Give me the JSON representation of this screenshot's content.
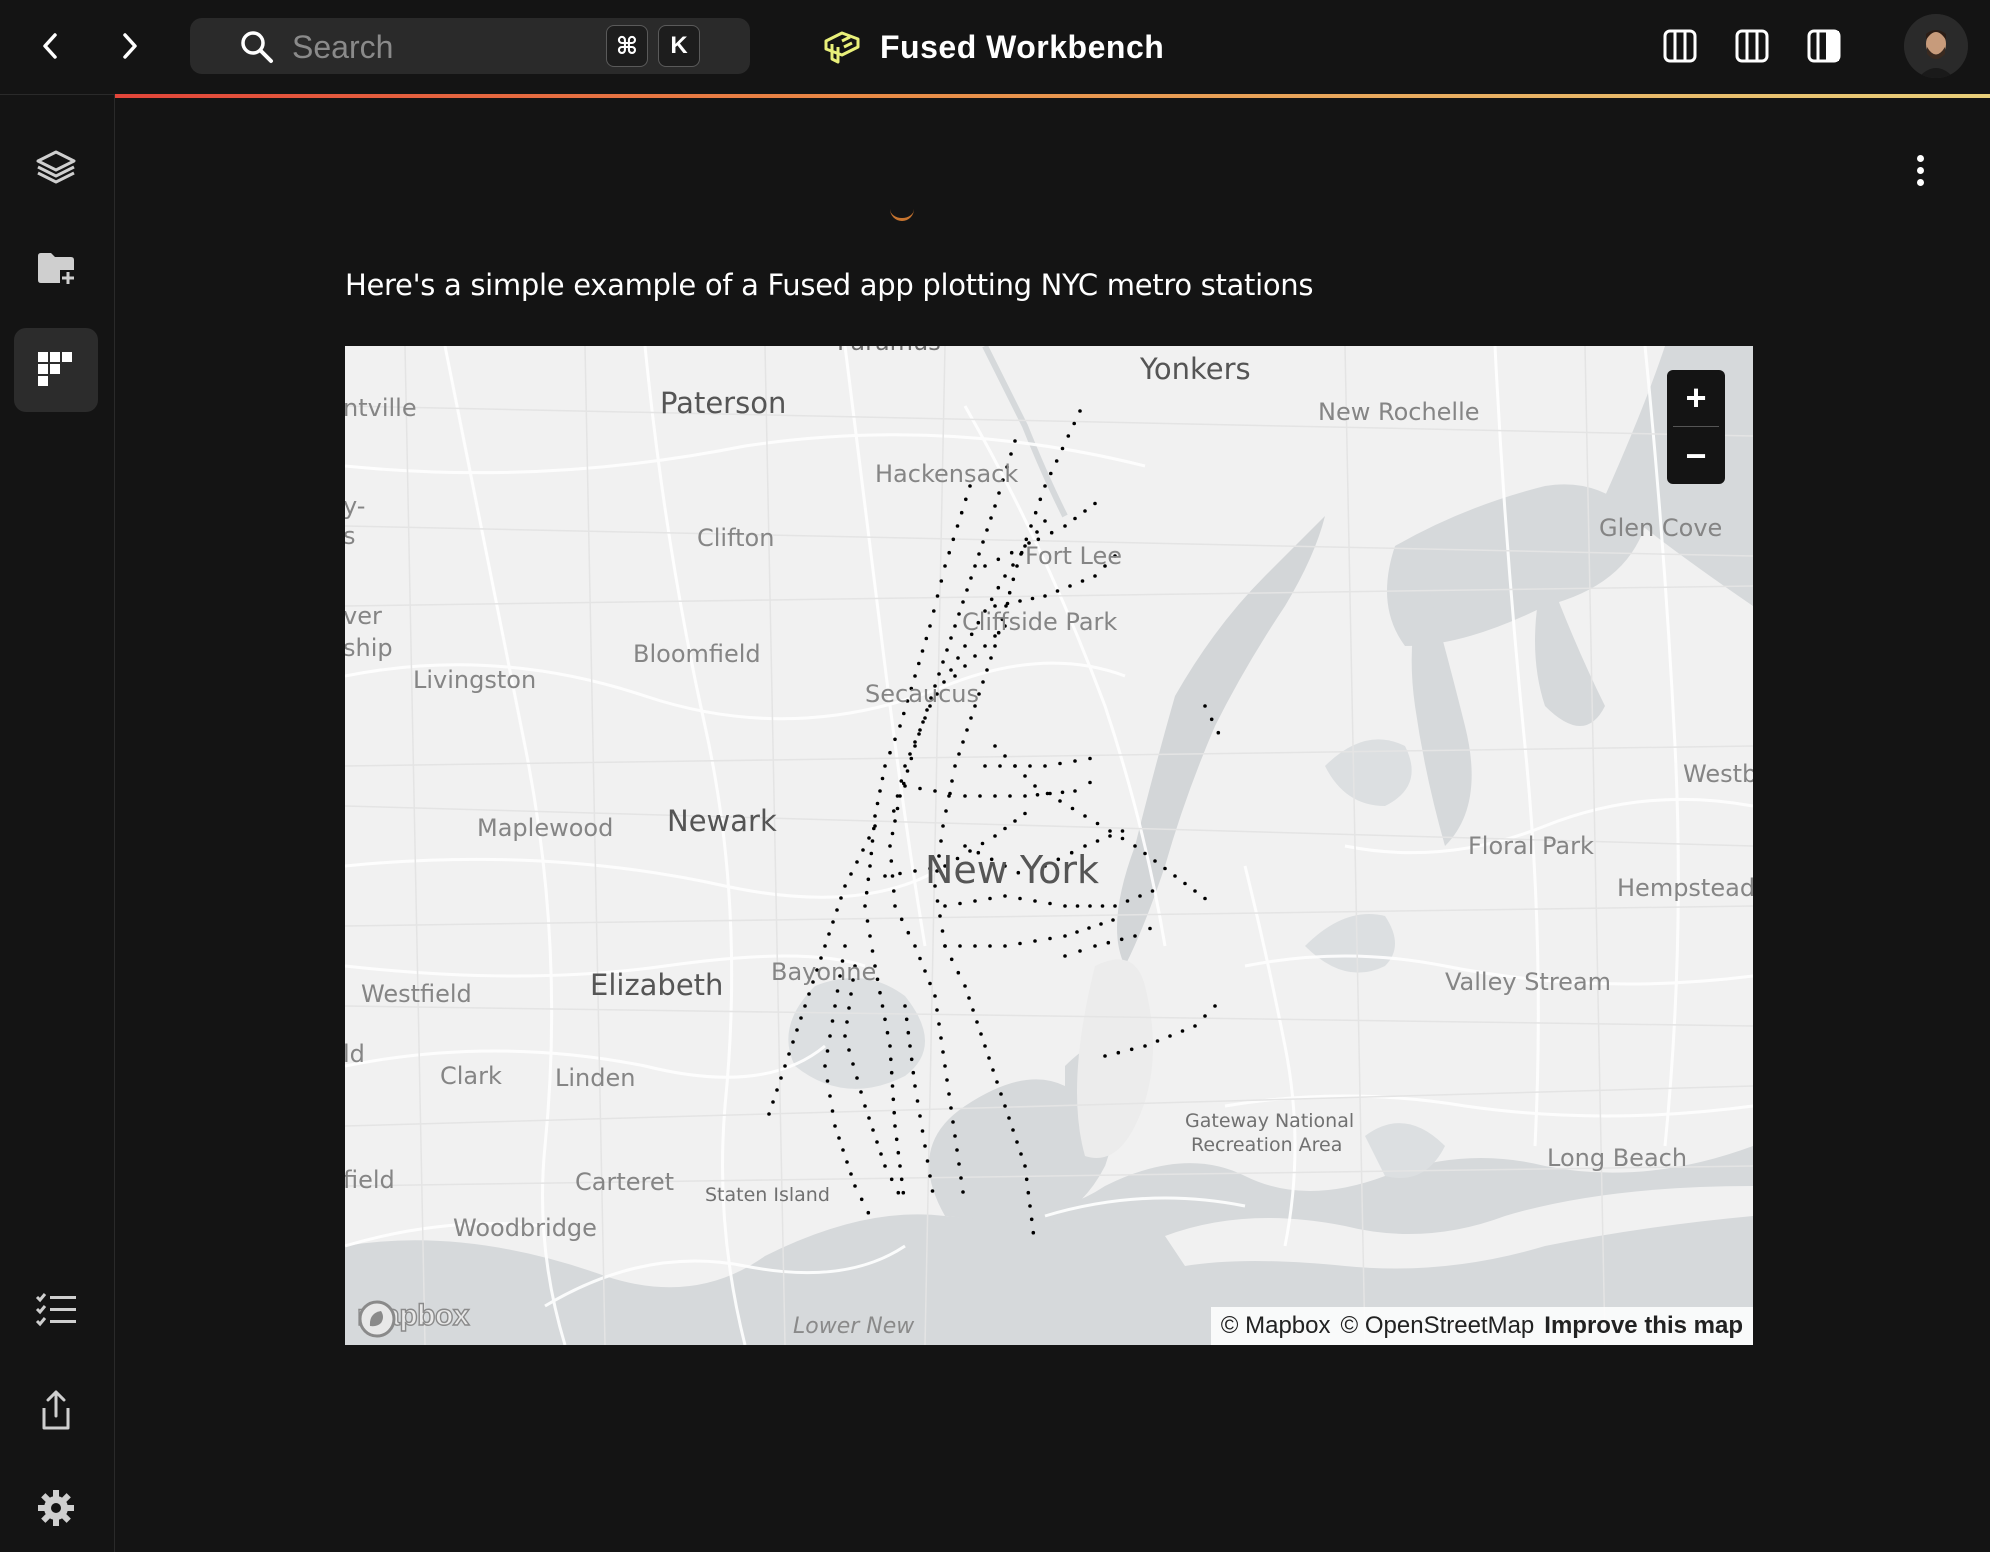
{
  "topbar": {
    "search_placeholder": "Search",
    "shortcut_cmd": "⌘",
    "shortcut_key": "K",
    "app_title": "Fused Workbench",
    "accent_gradient": [
      "#e2453a",
      "#e98a46",
      "#e9cf7a"
    ]
  },
  "sidebar": {
    "items": [
      {
        "name": "layers",
        "icon": "layers-icon"
      },
      {
        "name": "add-folder",
        "icon": "folder-plus-icon"
      },
      {
        "name": "apps",
        "icon": "apps-grid-icon",
        "active": true
      },
      {
        "name": "tasks",
        "icon": "checklist-icon"
      },
      {
        "name": "share",
        "icon": "share-icon"
      },
      {
        "name": "settings",
        "icon": "gear-icon"
      }
    ]
  },
  "content": {
    "description": "Here's a simple example of a Fused app plotting NYC metro stations"
  },
  "map": {
    "labels": [
      {
        "id": "paramus",
        "text": "Paramus"
      },
      {
        "id": "yonkers",
        "text": "Yonkers"
      },
      {
        "id": "new-rochelle",
        "text": "New Rochelle"
      },
      {
        "id": "paterson",
        "text": "Paterson"
      },
      {
        "id": "ntville",
        "text": "ntville"
      },
      {
        "id": "y",
        "text": "y-"
      },
      {
        "id": "s",
        "text": "s"
      },
      {
        "id": "hackensack",
        "text": "Hackensack"
      },
      {
        "id": "glen-cove",
        "text": "Glen Cove"
      },
      {
        "id": "clifton",
        "text": "Clifton"
      },
      {
        "id": "fort-lee",
        "text": "Fort Lee"
      },
      {
        "id": "ver",
        "text": "ver"
      },
      {
        "id": "ship",
        "text": "ship"
      },
      {
        "id": "cliffside-park",
        "text": "Cliffside Park"
      },
      {
        "id": "bloomfield",
        "text": "Bloomfield"
      },
      {
        "id": "livingston",
        "text": "Livingston"
      },
      {
        "id": "secaucus",
        "text": "Secaucus"
      },
      {
        "id": "westb",
        "text": "Westb"
      },
      {
        "id": "maplewood",
        "text": "Maplewood"
      },
      {
        "id": "newark",
        "text": "Newark"
      },
      {
        "id": "floral-park",
        "text": "Floral Park"
      },
      {
        "id": "new-york",
        "text": "New York"
      },
      {
        "id": "hempstead",
        "text": "Hempstead"
      },
      {
        "id": "bayonne",
        "text": "Bayonne"
      },
      {
        "id": "westfield",
        "text": "Westfield"
      },
      {
        "id": "elizabeth",
        "text": "Elizabeth"
      },
      {
        "id": "valley-stream",
        "text": "Valley Stream"
      },
      {
        "id": "ld",
        "text": "ld"
      },
      {
        "id": "clark",
        "text": "Clark"
      },
      {
        "id": "linden",
        "text": "Linden"
      },
      {
        "id": "gateway-1",
        "text": "Gateway National"
      },
      {
        "id": "gateway-2",
        "text": "Recreation Area"
      },
      {
        "id": "long-beach",
        "text": "Long Beach"
      },
      {
        "id": "field",
        "text": "field"
      },
      {
        "id": "carteret",
        "text": "Carteret"
      },
      {
        "id": "staten-island",
        "text": "Staten Island"
      },
      {
        "id": "woodbridge",
        "text": "Woodbridge"
      },
      {
        "id": "lower-new",
        "text": "Lower New"
      }
    ],
    "zoom_in": "+",
    "zoom_out": "−",
    "attribution": {
      "mapbox": "© Mapbox",
      "osm": "© OpenStreetMap",
      "improve": "Improve this map"
    },
    "logo_text": "mapbox",
    "marker_color": "#000000"
  }
}
